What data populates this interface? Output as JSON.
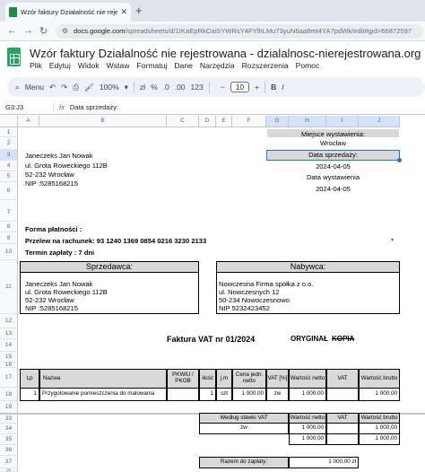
{
  "browser": {
    "tab_title": "Wzór faktury Działalność nie rejestrowana",
    "url_host": "docs.google.com",
    "url_path": "/spreadsheets/d/1IKaEpRkCaiSYWRsY4FYlhLMu73yuN6aa8mt4YA7pdWk/edit#gid=66872597"
  },
  "app": {
    "doc_title": "Wzór faktury Działalność nie rejestrowana - dzialalnosc-nierejestrowana.org",
    "menu": [
      "Plik",
      "Edytuj",
      "Widok",
      "Wstaw",
      "Formatuj",
      "Dane",
      "Narzędzia",
      "Rozszerzenia",
      "Pomoc"
    ]
  },
  "toolbar": {
    "menus": "Menu",
    "zoom": "100%",
    "currency": "zł",
    "percent": "%",
    "dec1": ".0",
    "dec2": ".00",
    "numfmt": "123",
    "font_size": "10"
  },
  "formula": {
    "cell_ref": "G3:J3",
    "content": "Data sprzedaży:"
  },
  "columns": [
    "A",
    "B",
    "C",
    "D",
    "E",
    "F",
    "G",
    "H",
    "I",
    "J"
  ],
  "rows": [
    "1",
    "2",
    "3",
    "4",
    "5",
    "6",
    "7",
    "8",
    "9",
    "10",
    "11",
    "12",
    "13",
    "14",
    "15",
    "16",
    "17",
    "18",
    "19",
    "33",
    "34",
    "35",
    "36",
    "37",
    "38"
  ],
  "invoice": {
    "seller_name": "Janeczeks Jan Nowak",
    "seller_street": "ul. Grota Roweckiego 112B",
    "seller_city": "52-232 Wrocław",
    "seller_nip": "NIP :5285168215",
    "place_label": "Miejsce wystawienia:",
    "place": "Wrocław",
    "sale_date_label": "Data sprzedaży:",
    "sale_date": "2024-04-05",
    "issue_date_label": "Data wystawienia",
    "issue_date": "2024-04-05",
    "payment_form": "Forma płatności :",
    "transfer": "Przelew na rachunek: 93 1240 1369 0854 0216 3230 2133",
    "due": "Termin zapłaty : 7 dni",
    "seller_header": "Sprzedawca:",
    "buyer_header": "Nabywca:",
    "buyer_name": "Nowczesna Firma spółka z o.o.",
    "buyer_street": "ul. Nowczesnych 12",
    "buyer_city": "50-234 Nowoczesnowo",
    "buyer_nip": "NIP 5232423452",
    "title": "Faktura VAT nr 01/2024",
    "original": "ORYGINAŁ",
    "copy": "KOPIA"
  },
  "table": {
    "headers": [
      "Lp",
      "Nazwa",
      "PKWiU / PKOB",
      "ilość",
      "j.m",
      "Cena jedn. netto",
      "VAT [%]",
      "Wartość netto",
      "VAT",
      "Wartość brutto"
    ],
    "row": [
      "1",
      "Przygotowanie pomieszczenia do malowania",
      "",
      "1",
      "szt",
      "1 000,00",
      "zw",
      "1 000,00",
      "",
      "1 000,00"
    ]
  },
  "summary": {
    "headers": [
      "Według stawki VAT",
      "Wartość netto",
      "VAT",
      "Wartość brutto"
    ],
    "row1": [
      "zw",
      "1 000,00",
      "",
      "1 000,00"
    ],
    "row2": [
      "",
      "1 000,00",
      "",
      "1 000,00"
    ],
    "total_label": "Razem do zapłaty:",
    "total": "1 000,00 zł"
  }
}
